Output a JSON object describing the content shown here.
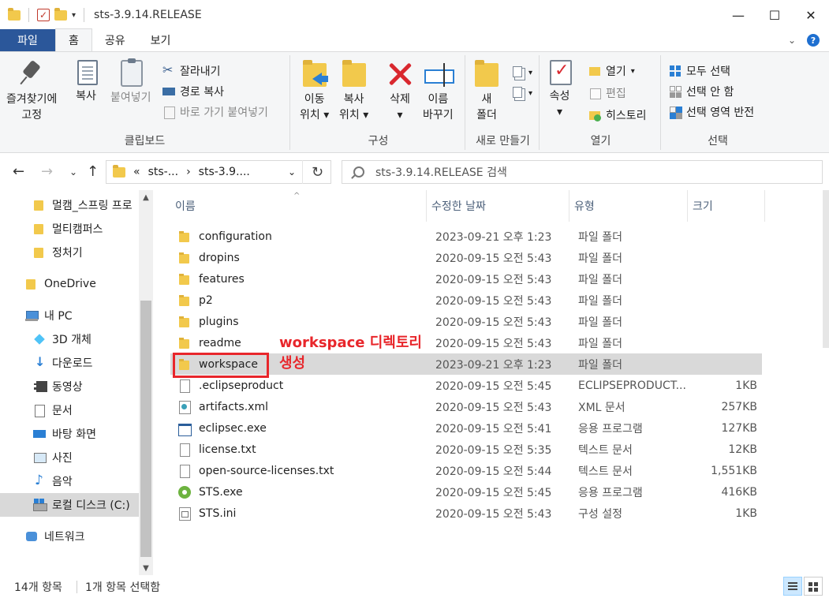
{
  "window": {
    "title": "sts-3.9.14.RELEASE"
  },
  "ribbon_tabs": [
    "파일",
    "홈",
    "공유",
    "보기"
  ],
  "ribbon": {
    "clipboard": {
      "label": "클립보드",
      "pin": "즐겨찾기에\n고정",
      "pin_line1": "즐겨찾기에",
      "pin_line2": "고정",
      "copy": "복사",
      "paste": "붙여넣기",
      "cut": "잘라내기",
      "copy_path": "경로 복사",
      "paste_shortcut": "바로 가기 붙여넣기"
    },
    "organize": {
      "label": "구성",
      "move_line1": "이동",
      "move_line2": "위치",
      "copy_line1": "복사",
      "copy_line2": "위치",
      "delete": "삭제",
      "rename_line1": "이름",
      "rename_line2": "바꾸기"
    },
    "new": {
      "label": "새로 만들기",
      "new_folder_line1": "새",
      "new_folder_line2": "폴더"
    },
    "open": {
      "label": "열기",
      "properties": "속성",
      "open": "열기",
      "edit": "편집",
      "history": "히스토리"
    },
    "select": {
      "label": "선택",
      "select_all": "모두 선택",
      "select_none": "선택 안 함",
      "invert": "선택 영역 반전"
    }
  },
  "address": {
    "crumb_overflow": "«",
    "crumb1": "sts-...",
    "crumb2": "sts-3.9....",
    "search_placeholder": "sts-3.9.14.RELEASE 검색"
  },
  "nav": [
    {
      "label": "멀캠_스프링 프로",
      "icon": "folder-icon"
    },
    {
      "label": "멀티캠퍼스",
      "icon": "folder-icon"
    },
    {
      "label": "정처기",
      "icon": "folder-icon"
    },
    {
      "label": "OneDrive",
      "icon": "onedrive-icon"
    },
    {
      "label": "내 PC",
      "icon": "pc-icon"
    },
    {
      "label": "3D 개체",
      "icon": "3d-objects-icon"
    },
    {
      "label": "다운로드",
      "icon": "downloads-icon"
    },
    {
      "label": "동영상",
      "icon": "videos-icon"
    },
    {
      "label": "문서",
      "icon": "documents-icon"
    },
    {
      "label": "바탕 화면",
      "icon": "desktop-icon"
    },
    {
      "label": "사진",
      "icon": "pictures-icon"
    },
    {
      "label": "음악",
      "icon": "music-icon"
    },
    {
      "label": "로컬 디스크 (C:)",
      "icon": "disk-icon"
    },
    {
      "label": "네트워크",
      "icon": "network-icon"
    }
  ],
  "columns": {
    "name": "이름",
    "date": "수정한 날짜",
    "type": "유형",
    "size": "크기"
  },
  "files": [
    {
      "name": "configuration",
      "date": "2023-09-21 오후 1:23",
      "type": "파일 폴더",
      "size": "",
      "icon": "folder-icon"
    },
    {
      "name": "dropins",
      "date": "2020-09-15 오전 5:43",
      "type": "파일 폴더",
      "size": "",
      "icon": "folder-icon"
    },
    {
      "name": "features",
      "date": "2020-09-15 오전 5:43",
      "type": "파일 폴더",
      "size": "",
      "icon": "folder-icon"
    },
    {
      "name": "p2",
      "date": "2020-09-15 오전 5:43",
      "type": "파일 폴더",
      "size": "",
      "icon": "folder-icon"
    },
    {
      "name": "plugins",
      "date": "2020-09-15 오전 5:43",
      "type": "파일 폴더",
      "size": "",
      "icon": "folder-icon"
    },
    {
      "name": "readme",
      "date": "2020-09-15 오전 5:43",
      "type": "파일 폴더",
      "size": "",
      "icon": "folder-icon"
    },
    {
      "name": "workspace",
      "date": "2023-09-21 오후 1:23",
      "type": "파일 폴더",
      "size": "",
      "icon": "folder-icon"
    },
    {
      "name": ".eclipseproduct",
      "date": "2020-09-15 오전 5:45",
      "type": "ECLIPSEPRODUCT...",
      "size": "1KB",
      "icon": "file-icon"
    },
    {
      "name": "artifacts.xml",
      "date": "2020-09-15 오전 5:43",
      "type": "XML 문서",
      "size": "257KB",
      "icon": "xml-file-icon"
    },
    {
      "name": "eclipsec.exe",
      "date": "2020-09-15 오전 5:41",
      "type": "응용 프로그램",
      "size": "127KB",
      "icon": "exe-icon"
    },
    {
      "name": "license.txt",
      "date": "2020-09-15 오전 5:35",
      "type": "텍스트 문서",
      "size": "12KB",
      "icon": "file-icon"
    },
    {
      "name": "open-source-licenses.txt",
      "date": "2020-09-15 오전 5:44",
      "type": "텍스트 문서",
      "size": "1,551KB",
      "icon": "file-icon"
    },
    {
      "name": "STS.exe",
      "date": "2020-09-15 오전 5:45",
      "type": "응용 프로그램",
      "size": "416KB",
      "icon": "sts-app-icon"
    },
    {
      "name": "STS.ini",
      "date": "2020-09-15 오전 5:43",
      "type": "구성 설정",
      "size": "1KB",
      "icon": "ini-file-icon"
    }
  ],
  "annotation": {
    "line1": "workspace 디렉토리",
    "line2": "생성",
    "color": "#e8262b"
  },
  "status": {
    "item_count": "14개 항목",
    "selected": "1개 항목 선택함"
  },
  "colors": {
    "file_tab": "#2b579a",
    "nav_selected": "#cce8ff",
    "row_selected": "#d9d9d9",
    "folder": "#f2c94c"
  }
}
